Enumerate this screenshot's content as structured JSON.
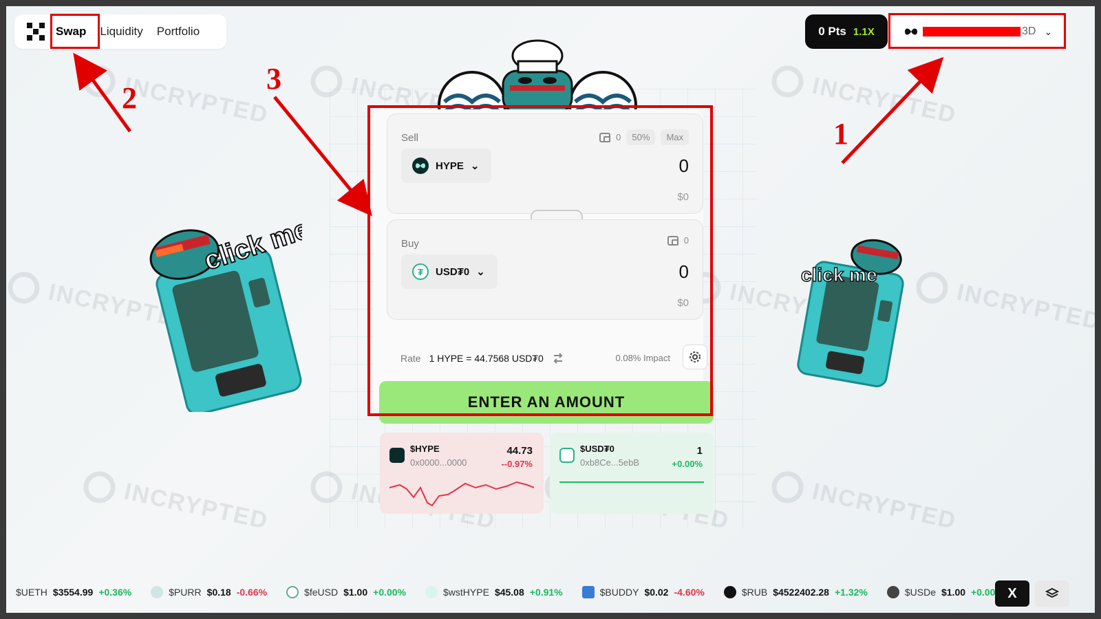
{
  "nav": {
    "items": [
      {
        "label": "Swap",
        "active": true
      },
      {
        "label": "Liquidity",
        "active": false
      },
      {
        "label": "Portfolio",
        "active": false
      }
    ]
  },
  "points": {
    "value": "0 Pts",
    "multiplier": "1.1X"
  },
  "wallet": {
    "suffix": "3D"
  },
  "annotations": {
    "one": "1",
    "two": "2",
    "three": "3"
  },
  "watermark": "INCRYPTED",
  "mascot_text": "click me",
  "swap": {
    "sell": {
      "label": "Sell",
      "balance": "0",
      "chip_half": "50%",
      "chip_max": "Max",
      "token": "HYPE",
      "amount": "0",
      "usd": "$0"
    },
    "buy": {
      "label": "Buy",
      "balance": "0",
      "token": "USD₮0",
      "amount": "0",
      "usd": "$0"
    },
    "rate_label": "Rate",
    "rate_value": "1 HYPE = 44.7568 USD₮0",
    "impact": "0.08% Impact",
    "cta": "ENTER AN AMOUNT"
  },
  "token_cards": [
    {
      "name": "$HYPE",
      "address": "0x0000...0000",
      "price": "44.73",
      "change": "--0.97%",
      "trend": "down"
    },
    {
      "name": "$USD₮0",
      "address": "0xb8Ce...5ebB",
      "price": "1",
      "change": "+0.00%",
      "trend": "flat"
    }
  ],
  "ticker": [
    {
      "symbol": "$UETH",
      "price": "$3554.99",
      "change": "+0.36%",
      "dir": "up"
    },
    {
      "symbol": "$PURR",
      "price": "$0.18",
      "change": "-0.66%",
      "dir": "down"
    },
    {
      "symbol": "$feUSD",
      "price": "$1.00",
      "change": "+0.00%",
      "dir": "up"
    },
    {
      "symbol": "$wstHYPE",
      "price": "$45.08",
      "change": "+0.91%",
      "dir": "up"
    },
    {
      "symbol": "$BUDDY",
      "price": "$0.02",
      "change": "-4.60%",
      "dir": "down"
    },
    {
      "symbol": "$RUB",
      "price": "$4522402.28",
      "change": "+1.32%",
      "dir": "up"
    },
    {
      "symbol": "$USDe",
      "price": "$1.00",
      "change": "+0.00",
      "dir": "up"
    }
  ],
  "footer": {
    "x_label": "X"
  },
  "colors": {
    "accent_green": "#9be87a",
    "annotation_red": "#e00000",
    "up": "#1bb75f",
    "down": "#e0334a"
  }
}
